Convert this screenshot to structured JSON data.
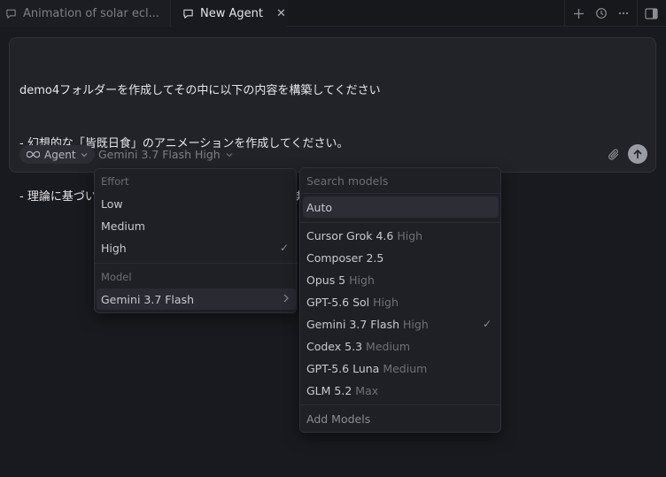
{
  "tabs": [
    {
      "label": "Animation of solar ecl...",
      "active": false
    },
    {
      "label": "New Agent",
      "active": true
    }
  ],
  "composer": {
    "lines": [
      "demo4フォルダーを作成してその中に以下の内容を構築してください",
      "- 幻想的な「皆既日食」のアニメーションを作成してください。",
      "- 理論に基づいた計算で皆既日食の一連の流れを表現する。"
    ],
    "agent_label": "Agent",
    "model_label": "Gemini 3.7 Flash High"
  },
  "effort_menu": {
    "effort_heading": "Effort",
    "effort_options": [
      "Low",
      "Medium",
      "High"
    ],
    "selected_effort": "High",
    "model_heading": "Model",
    "model_value": "Gemini 3.7 Flash"
  },
  "model_menu": {
    "search_placeholder": "Search models",
    "auto_label": "Auto",
    "models": [
      {
        "name": "Cursor Grok 4.6",
        "tier": "High"
      },
      {
        "name": "Composer 2.5",
        "tier": ""
      },
      {
        "name": "Opus 5",
        "tier": "High"
      },
      {
        "name": "GPT-5.6 Sol",
        "tier": "High"
      },
      {
        "name": "Gemini 3.7 Flash",
        "tier": "High"
      },
      {
        "name": "Codex 5.3",
        "tier": "Medium"
      },
      {
        "name": "GPT-5.6 Luna",
        "tier": "Medium"
      },
      {
        "name": "GLM 5.2",
        "tier": "Max"
      }
    ],
    "selected_model_index": 4,
    "add_models_label": "Add Models"
  },
  "icons": {
    "tab": "chat-bubble-icon",
    "close": "close-icon",
    "new_tab": "plus-icon",
    "history": "history-icon",
    "more": "more-icon",
    "sidebar": "sidebar-toggle-icon",
    "agent": "infinity-icon",
    "attach": "paperclip-icon",
    "send": "arrow-up-icon"
  },
  "colors": {
    "background": "#191a1f",
    "panel": "#222329",
    "menu": "#1f2025",
    "text": "#d4d4d8",
    "muted": "#6f7178"
  }
}
